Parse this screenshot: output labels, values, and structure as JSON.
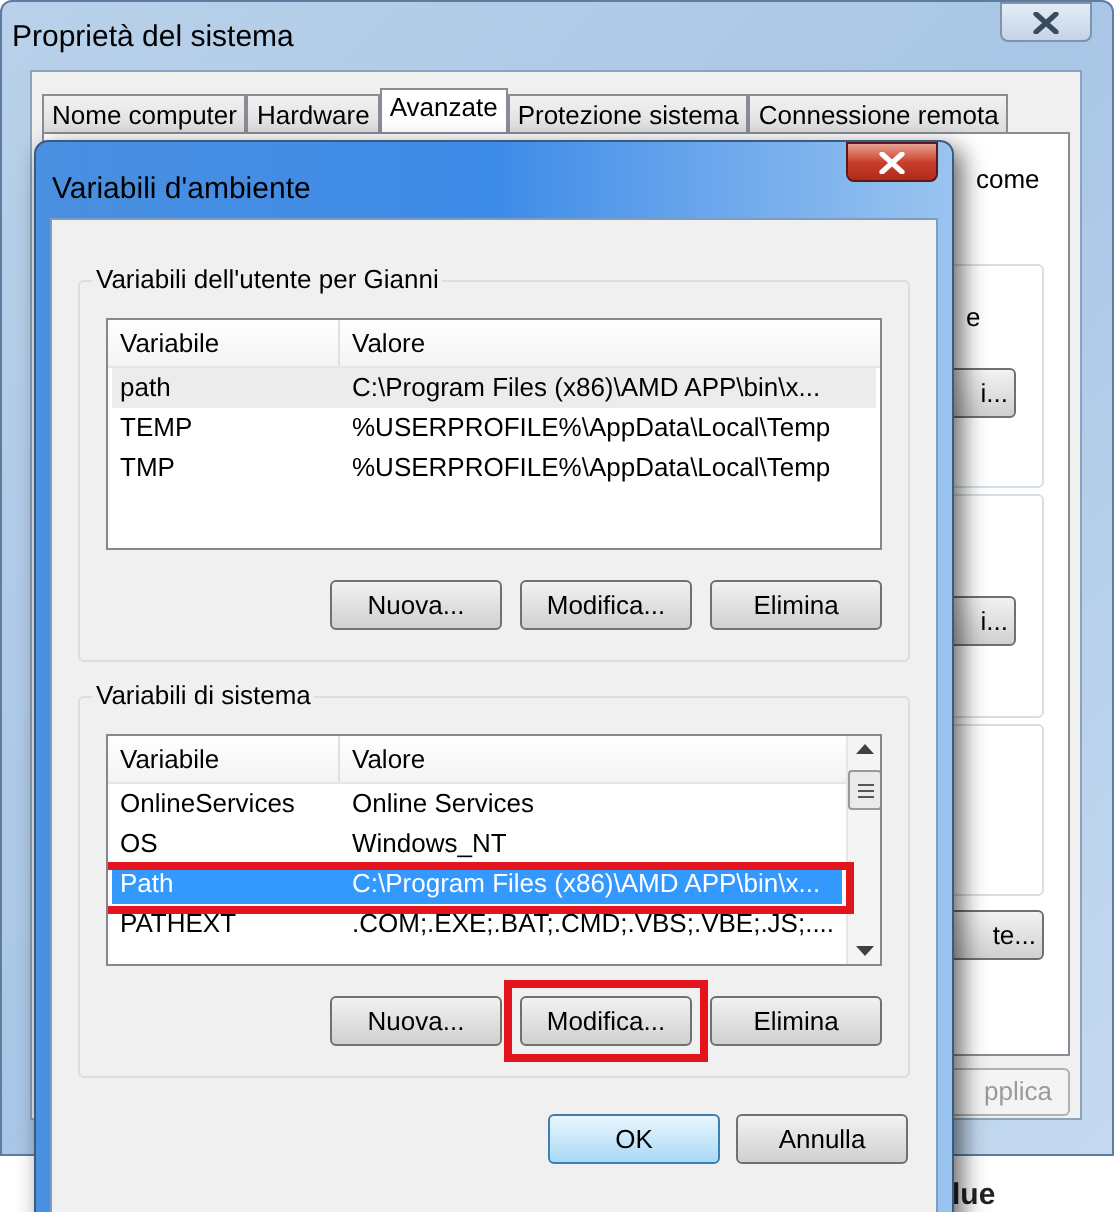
{
  "back_window": {
    "title": "Proprietà del sistema",
    "tabs": [
      {
        "label": "Nome computer",
        "selected": false
      },
      {
        "label": "Hardware",
        "selected": false
      },
      {
        "label": "Avanzate",
        "selected": true
      },
      {
        "label": "Protezione sistema",
        "selected": false
      },
      {
        "label": "Connessione remota",
        "selected": false
      }
    ],
    "text_fragments": [
      "come",
      "e"
    ],
    "button_fragments": [
      "i...",
      "i...",
      "te..."
    ],
    "apply_button": {
      "label": "pplica",
      "disabled": true
    },
    "bottom_fragment": "lue"
  },
  "dialog": {
    "title": "Variabili d'ambiente",
    "user_group": {
      "title": "Variabili dell'utente per Gianni",
      "columns": [
        "Variabile",
        "Valore"
      ],
      "rows": [
        {
          "name": "path",
          "value": "C:\\Program Files (x86)\\AMD APP\\bin\\x...",
          "selected": true,
          "highlighted": false
        },
        {
          "name": "TEMP",
          "value": "%USERPROFILE%\\AppData\\Local\\Temp",
          "selected": false,
          "highlighted": false
        },
        {
          "name": "TMP",
          "value": "%USERPROFILE%\\AppData\\Local\\Temp",
          "selected": false,
          "highlighted": false
        }
      ],
      "buttons": [
        {
          "label": "Nuova..."
        },
        {
          "label": "Modifica..."
        },
        {
          "label": "Elimina"
        }
      ]
    },
    "system_group": {
      "title": "Variabili di sistema",
      "columns": [
        "Variabile",
        "Valore"
      ],
      "rows": [
        {
          "name": "OnlineServices",
          "value": "Online Services",
          "selected": false,
          "highlighted": false
        },
        {
          "name": "OS",
          "value": "Windows_NT",
          "selected": false,
          "highlighted": false
        },
        {
          "name": "Path",
          "value": "C:\\Program Files (x86)\\AMD APP\\bin\\x...",
          "selected": true,
          "highlighted": true
        },
        {
          "name": "PATHEXT",
          "value": ".COM;.EXE;.BAT;.CMD;.VBS;.VBE;.JS;....",
          "selected": false,
          "highlighted": false
        }
      ],
      "buttons": [
        {
          "label": "Nuova..."
        },
        {
          "label": "Modifica...",
          "highlighted": true
        },
        {
          "label": "Elimina"
        }
      ]
    },
    "buttons": [
      {
        "label": "OK",
        "default": true
      },
      {
        "label": "Annulla",
        "default": false
      }
    ]
  }
}
